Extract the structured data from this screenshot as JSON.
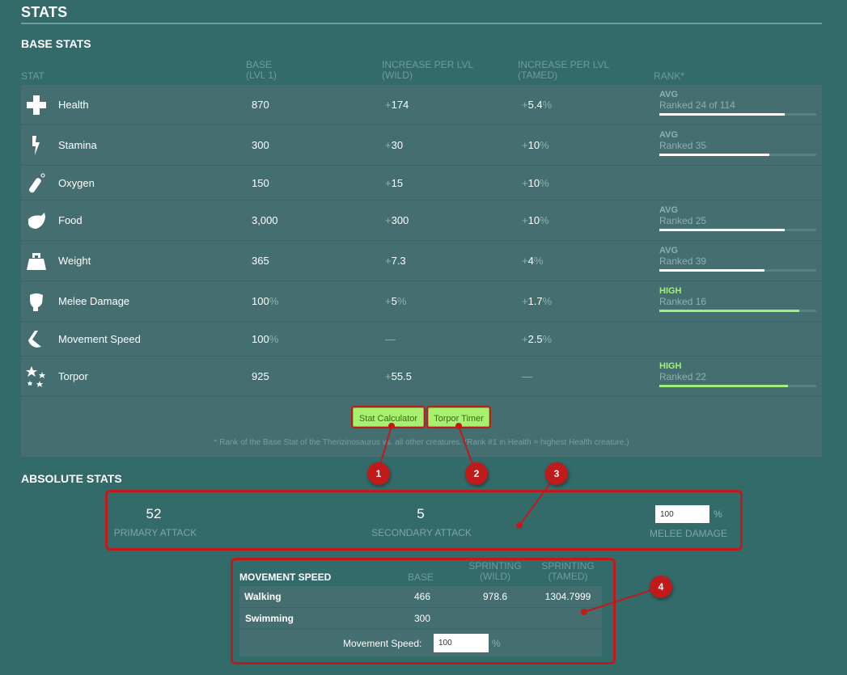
{
  "stats_title": "STATS",
  "base_stats": {
    "title": "BASE STATS",
    "headers": {
      "stat": "STAT",
      "base_line1": "BASE",
      "base_line2": "(LVL 1)",
      "wild_line1": "INCREASE PER LVL",
      "wild_line2": "(WILD)",
      "tamed_line1": "INCREASE PER LVL",
      "tamed_line2": "(TAMED)",
      "rank": "RANK*"
    },
    "rows": [
      {
        "icon": "health-cross-icon",
        "name": "Health",
        "base": "870",
        "base_unit": "",
        "wild_prefix": "+",
        "wild": "174",
        "wild_unit": "",
        "tamed_prefix": "+",
        "tamed": "5.4",
        "tamed_unit": "%",
        "rank_level": "AVG",
        "rank_text": "Ranked 24 of 114",
        "rank_fill": 0.8
      },
      {
        "icon": "stamina-bolt-icon",
        "name": "Stamina",
        "base": "300",
        "base_unit": "",
        "wild_prefix": "+",
        "wild": "30",
        "wild_unit": "",
        "tamed_prefix": "+",
        "tamed": "10",
        "tamed_unit": "%",
        "rank_level": "AVG",
        "rank_text": "Ranked 35",
        "rank_fill": 0.7
      },
      {
        "icon": "oxygen-tank-icon",
        "name": "Oxygen",
        "base": "150",
        "base_unit": "",
        "wild_prefix": "+",
        "wild": "15",
        "wild_unit": "",
        "tamed_prefix": "+",
        "tamed": "10",
        "tamed_unit": "%",
        "rank_level": "",
        "rank_text": "",
        "rank_fill": null
      },
      {
        "icon": "food-meat-icon",
        "name": "Food",
        "base": "3,000",
        "base_unit": "",
        "wild_prefix": "+",
        "wild": "300",
        "wild_unit": "",
        "tamed_prefix": "+",
        "tamed": "10",
        "tamed_unit": "%",
        "rank_level": "AVG",
        "rank_text": "Ranked 25",
        "rank_fill": 0.8
      },
      {
        "icon": "weight-icon",
        "name": "Weight",
        "base": "365",
        "base_unit": "",
        "wild_prefix": "+",
        "wild": "7.3",
        "wild_unit": "",
        "tamed_prefix": "+",
        "tamed": "4",
        "tamed_unit": "%",
        "rank_level": "AVG",
        "rank_text": "Ranked 39",
        "rank_fill": 0.67
      },
      {
        "icon": "melee-fist-icon",
        "name": "Melee Damage",
        "base": "100",
        "base_unit": "%",
        "wild_prefix": "+",
        "wild": "5",
        "wild_unit": "%",
        "tamed_prefix": "+",
        "tamed": "1.7",
        "tamed_unit": "%",
        "rank_level": "HIGH",
        "rank_text": "Ranked 16",
        "rank_fill": 0.89
      },
      {
        "icon": "movement-foot-icon",
        "name": "Movement Speed",
        "base": "100",
        "base_unit": "%",
        "wild_prefix": "",
        "wild": "—",
        "wild_unit": "",
        "tamed_prefix": "+",
        "tamed": "2.5",
        "tamed_unit": "%",
        "rank_level": "",
        "rank_text": "",
        "rank_fill": null
      },
      {
        "icon": "torpor-stars-icon",
        "name": "Torpor",
        "base": "925",
        "base_unit": "",
        "wild_prefix": "+",
        "wild": "55.5",
        "wild_unit": "",
        "tamed_prefix": "",
        "tamed": "—",
        "tamed_unit": "",
        "rank_level": "HIGH",
        "rank_text": "Ranked 22",
        "rank_fill": 0.82
      }
    ],
    "buttons": {
      "stat_calculator": "Stat Calculator",
      "torpor_timer": "Torpor Timer"
    },
    "footnote": "* Rank of the Base Stat of the Therizinosaurus vs. all other creatures. (Rank #1 in Health = highest Health creature.)"
  },
  "absolute_stats": {
    "title": "ABSOLUTE STATS",
    "primary_attack_value": "52",
    "primary_attack_label": "PRIMARY ATTACK",
    "secondary_attack_value": "5",
    "secondary_attack_label": "SECONDARY ATTACK",
    "melee_damage_input": "100",
    "melee_damage_unit": "%",
    "melee_damage_label": "MELEE DAMAGE"
  },
  "movement_speed": {
    "title": "MOVEMENT SPEED",
    "headers": {
      "base": "BASE",
      "wild_line1": "SPRINTING",
      "wild_line2": "(WILD)",
      "tamed_line1": "SPRINTING",
      "tamed_line2": "(TAMED)"
    },
    "rows": [
      {
        "name": "Walking",
        "base": "466",
        "wild": "978.6",
        "tamed": "1304.7999"
      },
      {
        "name": "Swimming",
        "base": "300",
        "wild": "",
        "tamed": ""
      }
    ],
    "input_label": "Movement Speed:",
    "input_value": "100",
    "input_unit": "%"
  },
  "annotations": {
    "marker_1": "1",
    "marker_2": "2",
    "marker_3": "3",
    "marker_4": "4",
    "color": "#c01a1a"
  },
  "colors": {
    "background": "#336b6b",
    "panel": "#446e70",
    "high": "#a2f07a",
    "button": "#a8f070"
  }
}
